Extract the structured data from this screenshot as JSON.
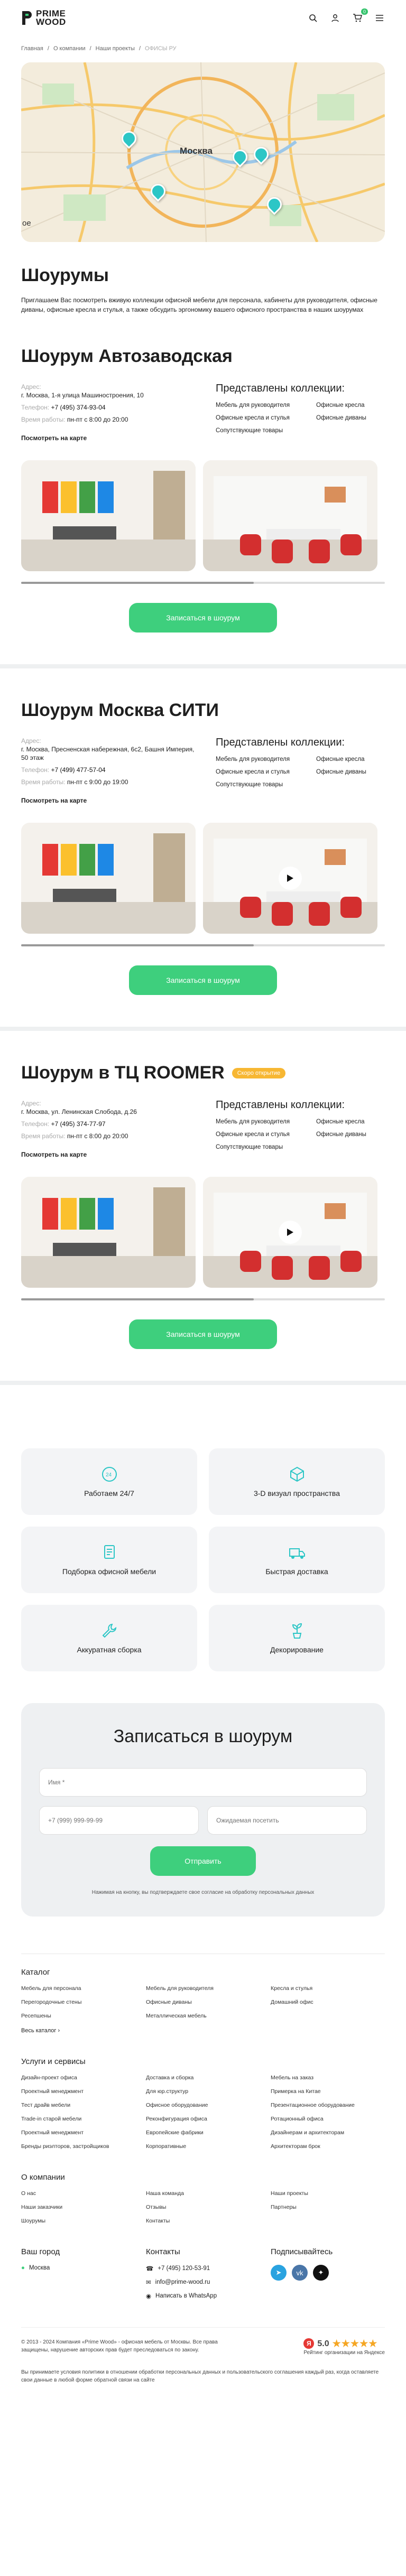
{
  "logo": {
    "line1": "PRIME",
    "line2": "WOOD"
  },
  "header": {
    "cart_count": "0"
  },
  "breadcrumbs": [
    "Главная",
    "О компании",
    "Наши проекты",
    "ОФИСЫ РУ"
  ],
  "map": {
    "city": "Москва",
    "corner": "ое"
  },
  "title": "Шоурумы",
  "intro": "Приглашаем Вас посмотреть вживую коллекции офисной мебели для персонала, кабинеты для руководителя, офисные диваны, офисные кресла и стулья, а также обсудить эргономику вашего офисного пространства в наших шоурумах",
  "showrooms": [
    {
      "name": "Шоурум Автозаводская",
      "chip": "",
      "address": "г. Москва, 1-я улица Машиностроения, 10",
      "phone": "+7 (495) 374-93-04",
      "hours": "пн-пт с 8:00 до 20:00"
    },
    {
      "name": "Шоурум Москва СИТИ",
      "chip": "",
      "address": "г. Москва, Пресненская набережная, 6с2, Башня Империя, 50 этаж",
      "phone": "+7 (499) 477-57-04",
      "hours": "пн-пт с 9:00 до 19:00"
    },
    {
      "name": "Шоурум в ТЦ ROOMER",
      "chip": "Скоро открытие",
      "address": "г. Москва, ул. Ленинская Слобода, д.26",
      "phone": "+7 (495) 374-77-97",
      "hours": "пн-пт с 8:00 до 20:00"
    }
  ],
  "labels": {
    "address": "Адрес:",
    "phone": "Телефон:",
    "hours": "Время работы:",
    "map_link": "Посмотреть на карте",
    "collections": "Представлены коллекции:",
    "book": "Записаться в шоурум"
  },
  "collections": [
    "Мебель для руководителя",
    "Офисные кресла",
    "Офисные кресла и стулья",
    "Офисные диваны",
    "Сопутствующие товары"
  ],
  "features": [
    {
      "icon": "clock-24-icon",
      "text": "Работаем 24/7"
    },
    {
      "icon": "cube-icon",
      "text": "3-D визуал пространства"
    },
    {
      "icon": "document-icon",
      "text": "Подборка офисной мебели"
    },
    {
      "icon": "truck-icon",
      "text": "Быстрая доставка"
    },
    {
      "icon": "wrench-icon",
      "text": "Аккуратная сборка"
    },
    {
      "icon": "plant-icon",
      "text": "Декорирование"
    }
  ],
  "form": {
    "title": "Записаться в шоурум",
    "name_ph": "Имя *",
    "phone_ph": "+7 (999) 999-99-99",
    "date_ph": "Ожидаемая посетить",
    "submit": "Отправить",
    "consent": "Нажимая на кнопку, вы подтверждаете свое согласие на обработку персональных данных"
  },
  "footer": {
    "catalog_title": "Каталог",
    "catalog": [
      "Мебель для персонала",
      "Мебель для руководителя",
      "Кресла и стулья",
      "Перегородочные стены",
      "Офисные диваны",
      "Домашний офис",
      "Ресепшены",
      "Металлическая мебель",
      ""
    ],
    "catalog_all": "Весь каталог",
    "services_title": "Услуги и сервисы",
    "services": [
      "Дизайн-проект офиса",
      "Доставка и сборка",
      "Мебель на заказ",
      "Проектный менеджмент",
      "Для юр.структур",
      "Примерка на Китае",
      "Тест драйв мебели",
      "Офисное оборудование",
      "Презентационное оборудование",
      "Trade-in старой мебели",
      "Реконфигурация офиса",
      "Ротационный офиса",
      "Проектный менеджмент",
      "Европейские фабрики",
      "Дизайнерам и архитекторам",
      "Бренды риэлторов, застройщиков",
      "Корпоративные",
      "Архитекторам брок"
    ],
    "about_title": "О компании",
    "about": [
      "О нас",
      "Наша команда",
      "Наши проекты",
      "Наши заказчики",
      "Отзывы",
      "Партнеры",
      "Шоурумы",
      "Контакты",
      ""
    ],
    "city_title": "Ваш город",
    "city": "Москва",
    "contacts_title": "Контакты",
    "phone": "+7 (495) 120-53-91",
    "email": "info@prime-wood.ru",
    "whatsapp": "Написать в WhatsApp",
    "social_title": "Подписывайтесь",
    "copyright": "© 2013 - 2024 Компания «Prime Wood» - офисная мебель от Москвы. Все права защищены, нарушение авторских прав будет преследоваться по закону.",
    "rating_value": "5.0",
    "rating_text": "Рейтинг организации на Яндексе",
    "legal": "Вы принимаете условия политики в отношении обработки персональных данных и пользовательского соглашения каждый раз, когда оставляете свои данные в любой форме обратной связи на сайте"
  },
  "colors": {
    "accent": "#3ecf7d",
    "pin": "#2cc6c6",
    "chip": "#f7b733"
  }
}
